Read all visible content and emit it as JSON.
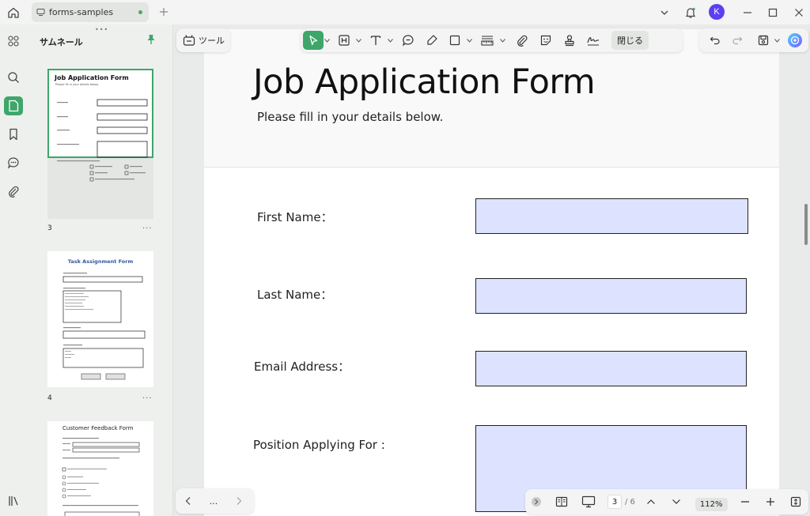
{
  "window": {
    "tab_title": "forms-samples",
    "avatar_initial": "K"
  },
  "sidebar": {
    "title": "サムネール",
    "thumbnails": [
      {
        "page": "3",
        "title": "Job Application Form",
        "subtitle": "Please fill in your details below."
      },
      {
        "page": "4",
        "title": "Task Assignment Form"
      },
      {
        "page": "",
        "title": "Customer Feedback Form"
      }
    ]
  },
  "toolbar": {
    "tools_label": "ツール",
    "close_label": "閉じる"
  },
  "document": {
    "title": "Job Application Form",
    "subtitle": "Please fill in your details below.",
    "fields": [
      {
        "label": "First Name："
      },
      {
        "label": "Last Name："
      },
      {
        "label": "Email Address："
      },
      {
        "label": "Position Applying For :"
      }
    ]
  },
  "footer": {
    "page_current": "3",
    "page_total": "/ 6",
    "zoom": "112%",
    "more": "..."
  },
  "colors": {
    "accent": "#3ea66a",
    "field_fill": "#dde3ff",
    "avatar": "#5b3ff0"
  }
}
